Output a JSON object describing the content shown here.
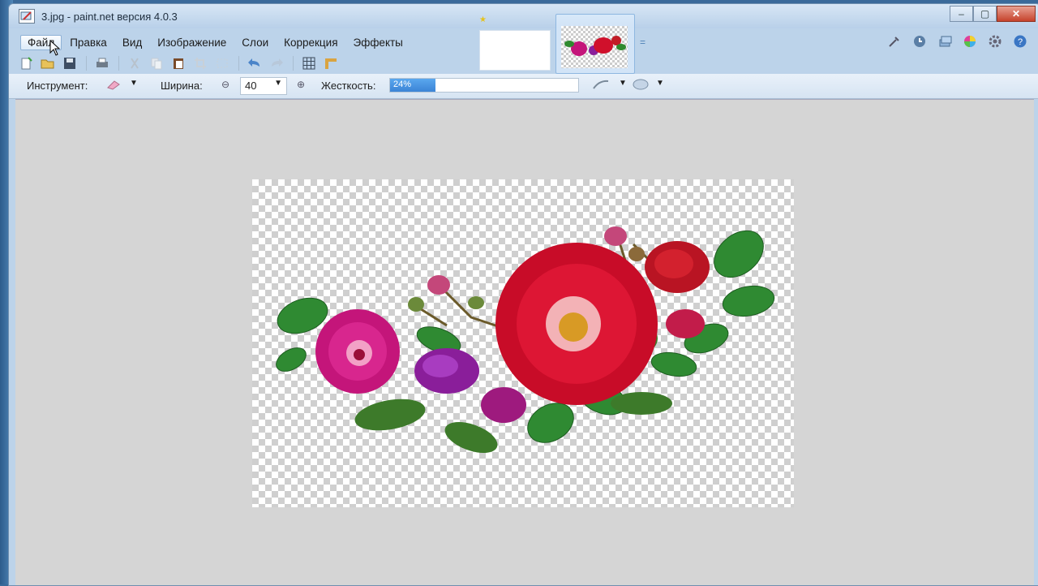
{
  "window": {
    "title": "3.jpg - paint.net версия 4.0.3",
    "minimize_glyph": "–",
    "maximize_glyph": "▢",
    "close_glyph": "✕"
  },
  "menu": [
    {
      "label": "Файл",
      "active": true
    },
    {
      "label": "Правка"
    },
    {
      "label": "Вид"
    },
    {
      "label": "Изображение"
    },
    {
      "label": "Слои"
    },
    {
      "label": "Коррекция"
    },
    {
      "label": "Эффекты"
    }
  ],
  "toolbar_icons": [
    "new-icon",
    "open-icon",
    "save-icon",
    "print-icon",
    "cut-icon",
    "copy-icon",
    "paste-icon",
    "crop-icon",
    "deselect-icon",
    "undo-icon",
    "redo-icon",
    "grid-icon",
    "ruler-icon"
  ],
  "right_icons": [
    "tools-icon",
    "history-icon",
    "layers-icon",
    "colors-icon",
    "settings-icon",
    "help-icon"
  ],
  "options": {
    "tool_label": "Инструмент:",
    "tool_icon": "eraser-icon",
    "width_label": "Ширина:",
    "width_value": "40",
    "hardness_label": "Жесткость:",
    "hardness_value": "24%",
    "hardness_fraction": 0.24
  },
  "colors": {
    "accent": "#3b84d6",
    "close": "#c6422b"
  }
}
